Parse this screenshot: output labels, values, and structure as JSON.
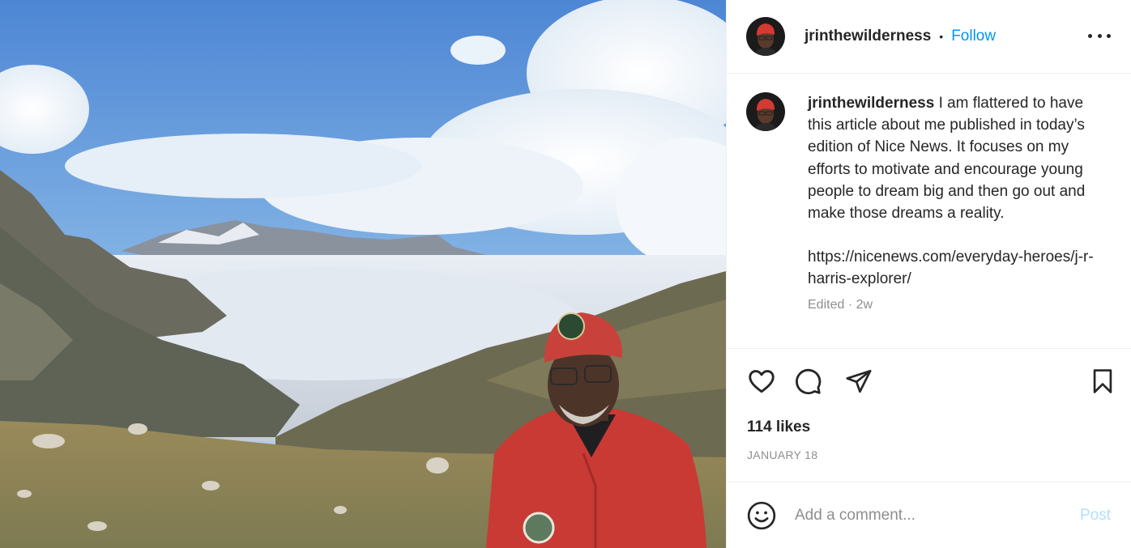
{
  "post": {
    "image_alt": "Man in a red cap and red jacket standing on a mountain ridge above a sea of clouds"
  },
  "header": {
    "username": "jrinthewilderness",
    "separator": "•",
    "follow_label": "Follow",
    "more_icon": "more-options-icon"
  },
  "caption": {
    "username": "jrinthewilderness",
    "text": "I am flattered to have this article about me published in today’s edition of Nice News. It focuses on my efforts to motivate and encourage young people to dream big and then go out and make those dreams a reality.",
    "link": "https://nicenews.com/everyday-heroes/j-r-harris-explorer/",
    "edited": "Edited",
    "meta_separator": "·",
    "time_ago": "2w"
  },
  "actions": {
    "icons": [
      "heart-icon",
      "comment-icon",
      "share-icon",
      "bookmark-icon"
    ],
    "likes": "114 likes",
    "date": "JANUARY 18"
  },
  "comment_box": {
    "emoji_icon": "emoji-icon",
    "placeholder": "Add a comment...",
    "post_label": "Post"
  },
  "colors": {
    "accent": "#0095f6",
    "post_disabled": "#b2dffc",
    "secondary_text": "#8e8e8e",
    "primary_text": "#262626"
  }
}
